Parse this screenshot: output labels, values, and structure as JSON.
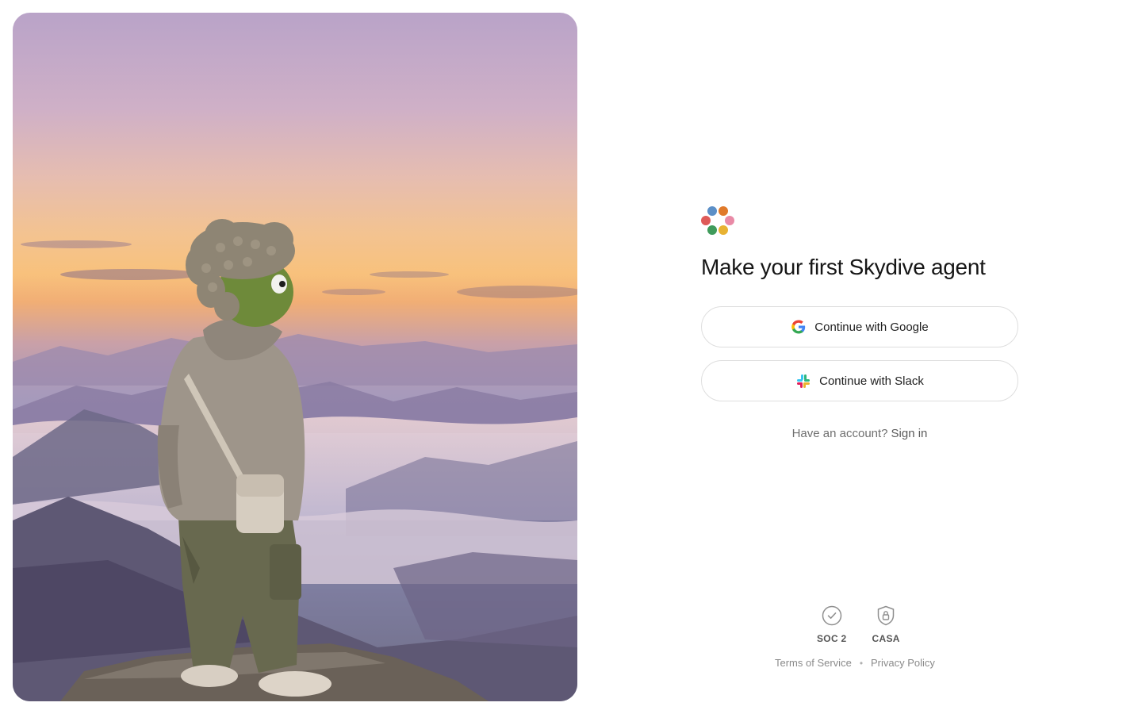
{
  "hero": {
    "image_alt": "Character in a hoodie standing on a rock above a sea of clouds at sunset"
  },
  "brand": {
    "logo_icon": "skydive-logo-icon",
    "colors": [
      "#5b8fc7",
      "#e07a2a",
      "#e98aa6",
      "#e8b232",
      "#3f9b5b",
      "#de5a58"
    ]
  },
  "signup": {
    "headline": "Make your first Skydive agent",
    "google_label": "Continue with Google",
    "slack_label": "Continue with Slack",
    "have_account": "Have an account?",
    "sign_in": "Sign in"
  },
  "footer": {
    "badges": [
      {
        "icon": "check-circle-icon",
        "label": "SOC 2"
      },
      {
        "icon": "shield-lock-icon",
        "label": "CASA"
      }
    ],
    "terms": "Terms of Service",
    "separator": "•",
    "privacy": "Privacy Policy"
  }
}
